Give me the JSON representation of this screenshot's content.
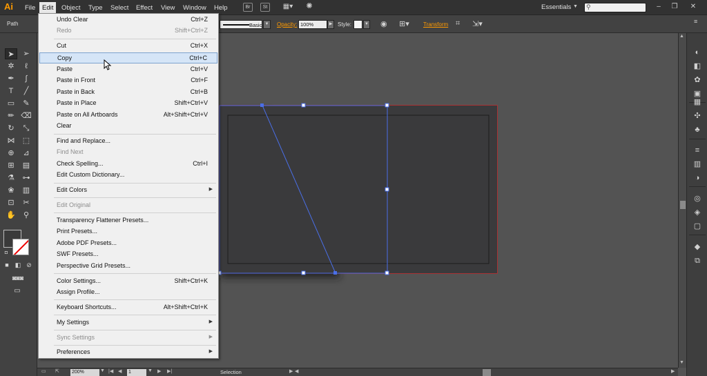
{
  "app": {
    "logo": "Ai",
    "workspace": "Essentials",
    "accent_color": "#ff9a00"
  },
  "menubar": {
    "items": [
      "File",
      "Edit",
      "Object",
      "Type",
      "Select",
      "Effect",
      "View",
      "Window",
      "Help"
    ],
    "active": "Edit",
    "icon_br": "Br",
    "icon_st": "St"
  },
  "controlbar": {
    "selection_label": "Path",
    "stroke_profile": "Basic",
    "opacity_label": "Opacity:",
    "opacity_value": "100%",
    "style_label": "Style:",
    "transform_label": "Transform"
  },
  "edit_menu": {
    "items": [
      {
        "label": "Undo Clear",
        "shortcut": "Ctrl+Z",
        "enabled": true
      },
      {
        "label": "Redo",
        "shortcut": "Shift+Ctrl+Z",
        "enabled": false
      },
      {
        "label": "Cut",
        "shortcut": "Ctrl+X",
        "enabled": true
      },
      {
        "label": "Copy",
        "shortcut": "Ctrl+C",
        "enabled": true,
        "highlighted": true
      },
      {
        "label": "Paste",
        "shortcut": "Ctrl+V",
        "enabled": true
      },
      {
        "label": "Paste in Front",
        "shortcut": "Ctrl+F",
        "enabled": true
      },
      {
        "label": "Paste in Back",
        "shortcut": "Ctrl+B",
        "enabled": true
      },
      {
        "label": "Paste in Place",
        "shortcut": "Shift+Ctrl+V",
        "enabled": true
      },
      {
        "label": "Paste on All Artboards",
        "shortcut": "Alt+Shift+Ctrl+V",
        "enabled": true
      },
      {
        "label": "Clear",
        "shortcut": "",
        "enabled": true
      },
      {
        "label": "Find and Replace...",
        "shortcut": "",
        "enabled": true
      },
      {
        "label": "Find Next",
        "shortcut": "",
        "enabled": false
      },
      {
        "label": "Check Spelling...",
        "shortcut": "Ctrl+I",
        "enabled": true
      },
      {
        "label": "Edit Custom Dictionary...",
        "shortcut": "",
        "enabled": true
      },
      {
        "label": "Edit Colors",
        "shortcut": "",
        "enabled": true,
        "submenu": true
      },
      {
        "label": "Edit Original",
        "shortcut": "",
        "enabled": false
      },
      {
        "label": "Transparency Flattener Presets...",
        "shortcut": "",
        "enabled": true
      },
      {
        "label": "Print Presets...",
        "shortcut": "",
        "enabled": true
      },
      {
        "label": "Adobe PDF Presets...",
        "shortcut": "",
        "enabled": true
      },
      {
        "label": "SWF Presets...",
        "shortcut": "",
        "enabled": true
      },
      {
        "label": "Perspective Grid Presets...",
        "shortcut": "",
        "enabled": true
      },
      {
        "label": "Color Settings...",
        "shortcut": "Shift+Ctrl+K",
        "enabled": true
      },
      {
        "label": "Assign Profile...",
        "shortcut": "",
        "enabled": true
      },
      {
        "label": "Keyboard Shortcuts...",
        "shortcut": "Alt+Shift+Ctrl+K",
        "enabled": true
      },
      {
        "label": "My Settings",
        "shortcut": "",
        "enabled": true,
        "submenu": true
      },
      {
        "label": "Sync Settings",
        "shortcut": "",
        "enabled": false,
        "submenu": true
      },
      {
        "label": "Preferences",
        "shortcut": "",
        "enabled": true,
        "submenu": true
      }
    ]
  },
  "statusbar": {
    "zoom": "200%",
    "page": "1",
    "status": "Selection"
  },
  "colors": {
    "selection": "#4a6fe8",
    "artboard_border": "#c8272b",
    "artwork_fill": "#3a3a3c"
  }
}
